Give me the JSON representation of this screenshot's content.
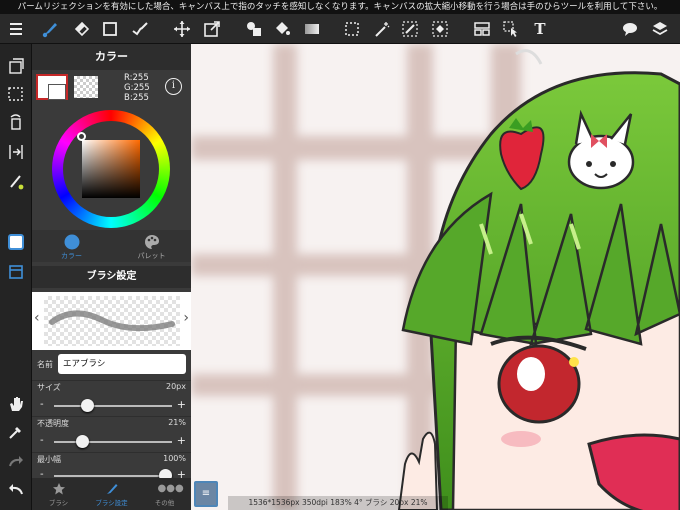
{
  "top_message": "パームリジェクションを有効にした場合、キャンバス上で指のタッチを感知しなくなります。キャンバスの拡大縮小移動を行う場合は手のひらツールを利用して下さい。",
  "toolbar": {
    "icons": [
      "menu-icon",
      "brush-icon",
      "eraser-icon",
      "rect-icon",
      "correction-icon",
      "move-icon",
      "transform-icon",
      "fill-shape-icon",
      "bucket-icon",
      "gradient-icon",
      "select-rect-icon",
      "magic-wand-icon",
      "select-pen-icon",
      "select-eraser-icon",
      "layer-move-icon",
      "operation-icon",
      "text-icon",
      "speech-bubble-icon",
      "layers-icon"
    ]
  },
  "color_panel": {
    "title": "カラー",
    "r": "R:255",
    "g": "G:255",
    "b": "B:255",
    "info": "i",
    "tab_color": "カラー",
    "tab_palette": "パレット"
  },
  "brush_panel": {
    "title": "ブラシ設定",
    "name_label": "名前",
    "name_value": "エアブラシ",
    "size_label": "サイズ",
    "size_value": "20px",
    "size_fraction": 0.26,
    "opacity_label": "不透明度",
    "opacity_value": "21%",
    "opacity_fraction": 0.21,
    "minwidth_label": "最小幅",
    "minwidth_value": "100%",
    "minwidth_fraction": 1.0
  },
  "bottom_tabs": [
    "ブラシ",
    "ブラシ設定",
    "その他"
  ],
  "status_text": "1536*1536px 350dpi 183% 4° ブラシ 20px 21%",
  "colors": {
    "accent_blue": "#3f8fd8",
    "toolbar_bg": "#2a2a2a",
    "hair_green": "#5fb52a"
  }
}
